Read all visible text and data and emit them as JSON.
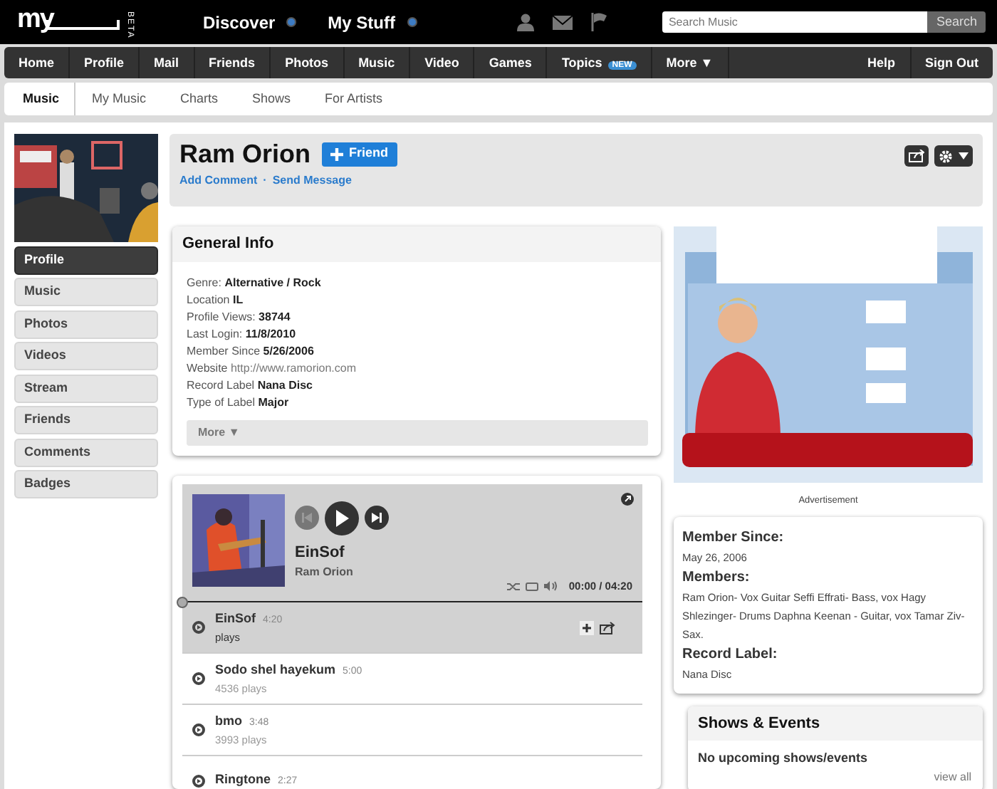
{
  "topbar": {
    "logo": "my",
    "beta": "BETA",
    "menus": [
      {
        "label": "Discover"
      },
      {
        "label": "My Stuff"
      }
    ],
    "search": {
      "placeholder": "Search Music",
      "button": "Search"
    }
  },
  "nav": {
    "left": [
      {
        "label": "Home"
      },
      {
        "label": "Profile"
      },
      {
        "label": "Mail"
      },
      {
        "label": "Friends"
      },
      {
        "label": "Photos"
      },
      {
        "label": "Music"
      },
      {
        "label": "Video"
      },
      {
        "label": "Games"
      },
      {
        "label": "Topics",
        "badge": "NEW"
      },
      {
        "label": "More ▼"
      }
    ],
    "right": [
      {
        "label": "Help"
      },
      {
        "label": "Sign Out"
      }
    ]
  },
  "subnav": [
    {
      "label": "Music",
      "selected": true
    },
    {
      "label": "My Music",
      "selected": false
    },
    {
      "label": "Charts",
      "selected": false
    },
    {
      "label": "Shows",
      "selected": false
    },
    {
      "label": "For Artists",
      "selected": false
    }
  ],
  "sidebar": {
    "items": [
      {
        "label": "Profile",
        "selected": true
      },
      {
        "label": "Music",
        "selected": false
      },
      {
        "label": "Photos",
        "selected": false
      },
      {
        "label": "Videos",
        "selected": false
      },
      {
        "label": "Stream",
        "selected": false
      },
      {
        "label": "Friends",
        "selected": false
      },
      {
        "label": "Comments",
        "selected": false
      },
      {
        "label": "Badges",
        "selected": false
      }
    ]
  },
  "profile": {
    "name": "Ram Orion",
    "friend_button": "Friend",
    "links": [
      "Add Comment",
      "Send Message"
    ],
    "separator": "·"
  },
  "general_info": {
    "title": "General Info",
    "lines": [
      {
        "label": "Genre:",
        "value": "Alternative / Rock",
        "kind": "bold"
      },
      {
        "label": "Location",
        "value": "IL",
        "kind": "bold"
      },
      {
        "label": "Profile Views:",
        "value": "38744",
        "kind": "bold"
      },
      {
        "label": "Last Login:",
        "value": "11/8/2010",
        "kind": "bold"
      },
      {
        "label": "Member Since",
        "value": "5/26/2006",
        "kind": "bold"
      },
      {
        "label": "Website",
        "value": "http://www.ramorion.com",
        "kind": "link"
      },
      {
        "label": "Record Label",
        "value": "Nana Disc",
        "kind": "bold"
      },
      {
        "label": "Type of Label",
        "value": "Major",
        "kind": "bold"
      }
    ],
    "more": "More ▼"
  },
  "player": {
    "title": "EinSof",
    "artist": "Ram Orion",
    "time": "00:00 / 04:20",
    "progress": {
      "level": 0
    },
    "tracks": [
      {
        "title": "EinSof",
        "duration": "4:20",
        "plays": "plays",
        "selected": true
      },
      {
        "title": "Sodo shel hayekum",
        "duration": "5:00",
        "plays": "4536 plays",
        "selected": false
      },
      {
        "title": "bmo",
        "duration": "3:48",
        "plays": "3993 plays",
        "selected": false
      },
      {
        "title": "Ringtone",
        "duration": "2:27",
        "selected": false
      }
    ]
  },
  "advertisement": {
    "label": "Advertisement"
  },
  "about": [
    {
      "heading": "Member Since:",
      "text": "May 26, 2006"
    },
    {
      "heading": "Members:",
      "text": "Ram Orion- Vox Guitar Seffi Effrati- Bass, vox Hagy Shlezinger- Drums Daphna Keenan - Guitar, vox Tamar Ziv- Sax."
    },
    {
      "heading": "Record Label:",
      "text": "Nana Disc"
    }
  ],
  "shows": {
    "title": "Shows & Events",
    "empty": "No upcoming shows/events",
    "view_all": "view all"
  }
}
